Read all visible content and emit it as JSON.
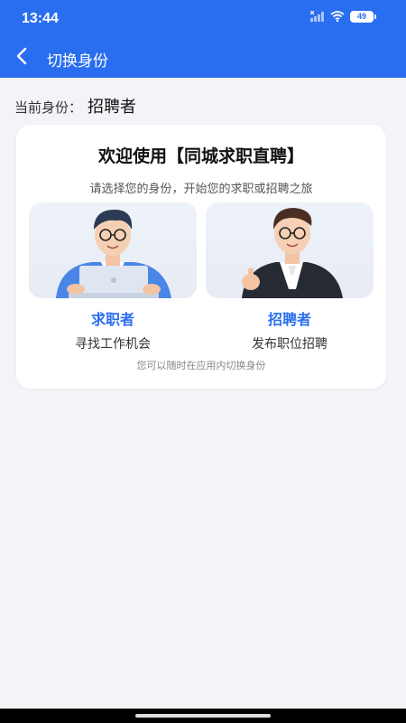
{
  "status_bar": {
    "time": "13:44",
    "battery": "49",
    "icons": [
      "signal-icon",
      "wifi-icon",
      "battery-icon"
    ]
  },
  "nav": {
    "title": "切换身份",
    "back_icon": "chevron-left-icon"
  },
  "current": {
    "label": "当前身份：",
    "value": "招聘者"
  },
  "card": {
    "title": "欢迎使用【同城求职直聘】",
    "subtitle": "请选择您的身份，开始您的求职或招聘之旅",
    "roles": [
      {
        "name": "求职者",
        "desc": "寻找工作机会"
      },
      {
        "name": "招聘者",
        "desc": "发布职位招聘"
      }
    ],
    "hint": "您可以随时在应用内切换身份"
  },
  "colors": {
    "primary": "#2a6ef0",
    "background": "#f3f4f8",
    "card": "#ffffff"
  }
}
